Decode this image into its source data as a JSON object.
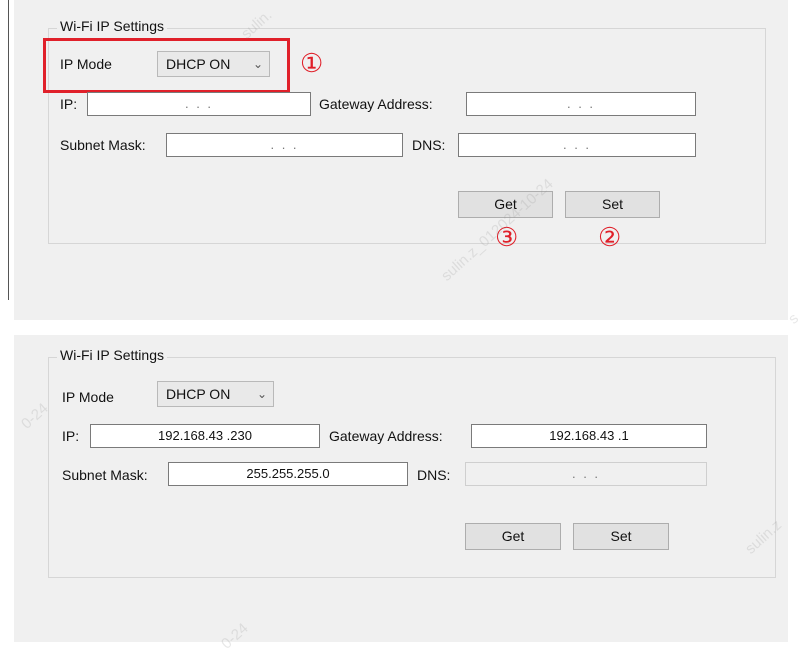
{
  "top": {
    "group_title": "Wi-Fi IP Settings",
    "ip_mode_label": "IP Mode",
    "ip_mode_value": "DHCP ON",
    "ip_label": "IP:",
    "ip_value": ". . .",
    "gateway_label": "Gateway Address:",
    "gateway_value": ". . .",
    "subnet_label": "Subnet Mask:",
    "subnet_value": ". . .",
    "dns_label": "DNS:",
    "dns_value": ". . .",
    "get_label": "Get",
    "set_label": "Set",
    "annotations": {
      "step1": "①",
      "step2": "②",
      "step3": "③"
    },
    "highlight_color": "#e0202a"
  },
  "bottom": {
    "group_title": "Wi-Fi IP Settings",
    "ip_mode_label": "IP Mode",
    "ip_mode_value": "DHCP ON",
    "ip_label": "IP:",
    "ip_value": "192.168.43 .230",
    "gateway_label": "Gateway Address:",
    "gateway_value": "192.168.43 .1",
    "subnet_label": "Subnet Mask:",
    "subnet_value": "255.255.255.0",
    "dns_label": "DNS:",
    "dns_value": ". . .",
    "get_label": "Get",
    "set_label": "Set"
  },
  "watermarks": {
    "top_center": "sulin.z_012024-10-24",
    "top_left": "sulin.",
    "top_right_corner": "s",
    "bottom_left": "0-24",
    "bottom_right": "sulin.z",
    "bottom_center": "0-24"
  },
  "icons": {
    "dropdown_arrow": "chevron-down-icon"
  }
}
